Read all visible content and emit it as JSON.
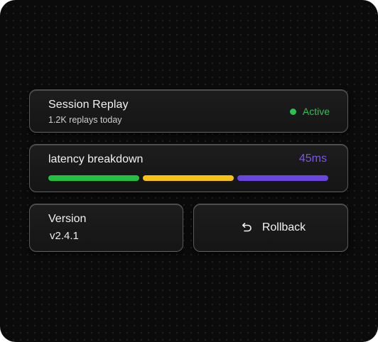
{
  "colors": {
    "status_green": "#2bc34c",
    "latency_accent": "#7c55e8",
    "bar_green": "#22c040",
    "bar_yellow": "#f7c211",
    "bar_purple": "#6b45e0"
  },
  "session": {
    "title": "Session Replay",
    "subtitle": "1.2K replays today",
    "status_label": "Active"
  },
  "latency": {
    "title": "latency breakdown",
    "value": "45ms",
    "segments": [
      {
        "color": "#22c040"
      },
      {
        "color": "#f7c211"
      },
      {
        "color": "#6b45e0"
      }
    ]
  },
  "version": {
    "label": "Version",
    "value": "v2.4.1"
  },
  "rollback": {
    "label": "Rollback",
    "icon": "undo-icon"
  }
}
